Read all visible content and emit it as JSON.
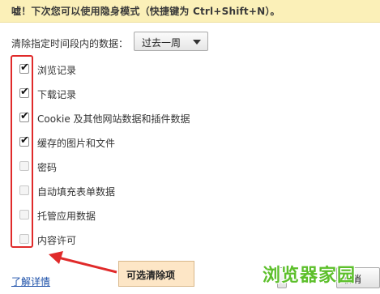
{
  "tip": {
    "text": "嘘！下次您可以使用隐身模式（快捷键为 Ctrl+Shift+N）。"
  },
  "time_range": {
    "label": "清除指定时间段内的数据：",
    "selected": "过去一周"
  },
  "items": [
    {
      "label": "浏览记录",
      "checked": true
    },
    {
      "label": "下载记录",
      "checked": true
    },
    {
      "label": "Cookie 及其他网站数据和插件数据",
      "checked": true
    },
    {
      "label": "缓存的图片和文件",
      "checked": true
    },
    {
      "label": "密码",
      "checked": false
    },
    {
      "label": "自动填充表单数据",
      "checked": false
    },
    {
      "label": "托管应用数据",
      "checked": false
    },
    {
      "label": "内容许可",
      "checked": false
    }
  ],
  "footer": {
    "details_link": "了解详情",
    "annotation": "可选清除项",
    "cancel_partial": "取消"
  },
  "watermark": "浏览器家园",
  "colors": {
    "highlight_border": "#e02a2a",
    "tip_background": "#fbf0b8",
    "annotation_bg": "#fde6c6",
    "watermark": "#5cbf2a"
  }
}
